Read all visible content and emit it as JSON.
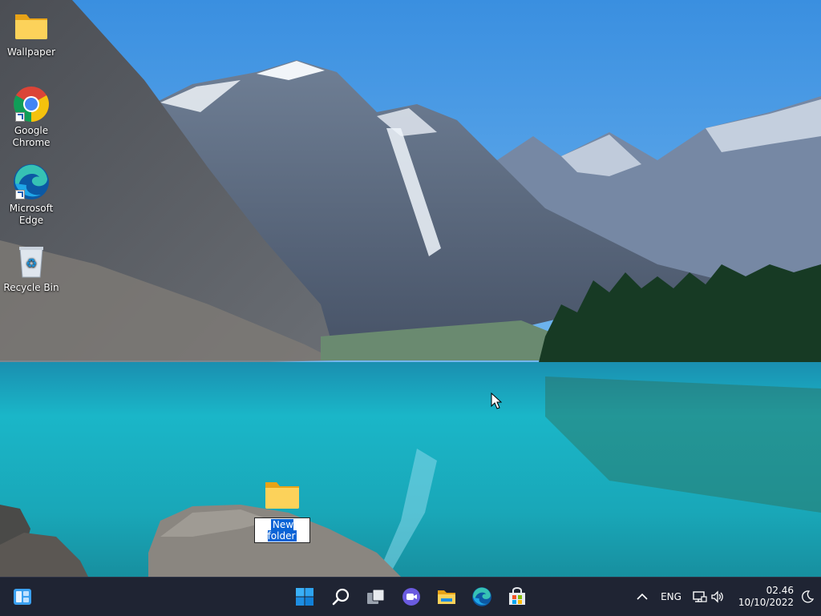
{
  "desktop": {
    "icons": [
      {
        "label": "Wallpaper",
        "icon": "folder-icon"
      },
      {
        "label": "Google Chrome",
        "icon": "chrome-icon"
      },
      {
        "label": "Microsoft Edge",
        "icon": "edge-icon"
      },
      {
        "label": "Recycle Bin",
        "icon": "recycle-bin-icon"
      }
    ],
    "new_folder": {
      "label": "New folder",
      "icon": "folder-icon",
      "state": "renaming"
    }
  },
  "taskbar": {
    "widgets_icon": "widgets-icon",
    "apps": [
      {
        "name": "Start",
        "icon": "windows-start-icon"
      },
      {
        "name": "Search",
        "icon": "search-icon"
      },
      {
        "name": "Task View",
        "icon": "task-view-icon"
      },
      {
        "name": "Chat",
        "icon": "chat-icon"
      },
      {
        "name": "File Explorer",
        "icon": "file-explorer-icon"
      },
      {
        "name": "Microsoft Edge",
        "icon": "edge-icon"
      },
      {
        "name": "Microsoft Store",
        "icon": "store-icon"
      }
    ],
    "tray": {
      "chevron_icon": "chevron-up-icon",
      "language": "ENG",
      "network_icon": "network-icon",
      "volume_icon": "volume-icon",
      "time": "02.46",
      "date": "10/10/2022",
      "focus_icon": "moon-icon"
    }
  }
}
